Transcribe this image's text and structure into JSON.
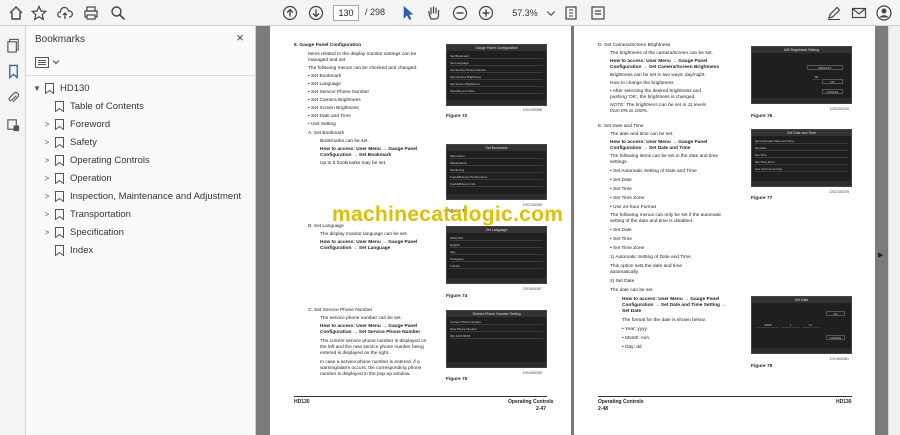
{
  "toolbar": {
    "page_current": "130",
    "page_total": "/ 298",
    "zoom": "57.3%"
  },
  "bookmarks": {
    "title": "Bookmarks",
    "close": "×",
    "root": "HD130",
    "items": [
      {
        "label": "Table of Contents",
        "expandable": false
      },
      {
        "label": "Foreword",
        "expandable": true
      },
      {
        "label": "Safety",
        "expandable": true
      },
      {
        "label": "Operating Controls",
        "expandable": true
      },
      {
        "label": "Operation",
        "expandable": true
      },
      {
        "label": "Inspection, Maintenance and Adjustment",
        "expandable": true
      },
      {
        "label": "Transportation",
        "expandable": true
      },
      {
        "label": "Specification",
        "expandable": true
      },
      {
        "label": "Index",
        "expandable": false
      }
    ]
  },
  "watermark": "machinecatalogic.com",
  "left_page": {
    "lines": [
      "6.      Gauge Panel Configuration",
      "Items related to the display monitor settings can be",
      "managed and set.",
      "The following menus can be checked and changed.",
      "•    Set Bookmark",
      "•    Set Language",
      "•    Set Service Phone Number",
      "•    Set Camera Brightness",
      "•    Set Screen Brightness",
      "•    Set Date and Time",
      "•    Unit Setting",
      "A.   Set Bookmark",
      "Bookmarks can be set.",
      "How to access: User Menu → Gauge Panel",
      "Configuration → Set Bookmark",
      "Up to 5 bookmarks may be set.",
      "B.   Set Language",
      "The display monitor language can be set.",
      "How to access: User Menu → Gauge Panel",
      "Configuration → Set Language",
      "C.   Set Service Phone Number",
      "The service phone number can be set.",
      "How to access: User Menu → Gauge Panel",
      "Configuration → Set Service Phone Number",
      "The current service phone number is displayed on",
      "the left and the new service phone number being",
      "entered is displayed on the right.",
      "In case a service phone number is entered, if a",
      "warning/alarm occurs, the corresponding phone",
      "number is displayed in the pop-up window."
    ],
    "figures": [
      {
        "title": "Gauge Panel Configuration",
        "caption": "Figure 72",
        "code": "DS2100398"
      },
      {
        "title": "Set Bookmark",
        "caption": "Figure 73",
        "code": "DS2100399"
      },
      {
        "title": "Set Language",
        "caption": "Figure 74",
        "code": "DS1900397"
      },
      {
        "title": "Service Phone Number Setting",
        "caption": "Figure 75",
        "code": "DS1900399"
      }
    ],
    "fig_rows": [
      [
        "Set Bookmark",
        "Set Language",
        "Set Service Phone Number",
        "Set Camera Brightness",
        "Set Screen Brightness",
        "Set Date and Time"
      ],
      [
        "Main Menu",
        "Maintenance",
        "Monitoring",
        "Fuel Efficiency Performance",
        "Fuel Efficiency Info"
      ],
      [
        "ENGLISH",
        "English",
        "Italy",
        "Portugues",
        "Turkish"
      ],
      [
        "Current Phone Number",
        "New Phone Number",
        "031 1234 5678"
      ]
    ],
    "footer_left": "HD130",
    "footer_right": "Operating Controls",
    "page_no": "2-47"
  },
  "right_page": {
    "lines": [
      "D.   Set Camera/Screen Brightness",
      "The brightness of the camera/screen can be set.",
      "How to access: User Menu → Gauge Panel",
      "Configuration → Set Camera/Screen Brightness",
      "Brightness can be set in two ways: day/night.",
      "How to change the brightness",
      "•    After selecting the desired brightness and",
      "      pushing 'OK', the brightness is changed.",
      "NOTE:   The brightness can be set in 11 levels",
      "              from 0% to 100%.",
      "E.   Set Date and Time",
      "The date and time can be set.",
      "How to access: User Menu → Gauge Panel",
      "Configuration → Set Date and Time",
      "The following items can be set in the date and time",
      "settings.",
      "•    Set Automatic Setting of Date and Time",
      "•    Set Date",
      "•    Set Time",
      "•    Set Time Zone",
      "•    Use 24-hour Format",
      "The following menus can only be set if the automatic",
      "setting of the date and time is disabled.",
      "•    Set Date",
      "•    Set Time",
      "•    Set Time Zone",
      "1)    Automatic Setting of Date and Time",
      "        This option sets the date and time",
      "        automatically.",
      "2)    Set Date",
      "        The date can be set.",
      "How to access: User Menu → Gauge Panel",
      "Configuration → Set Date and Time Setting →",
      "Set Date",
      "The format for the date is shown below.",
      "•    Year: yyyy",
      "•    Month: mm",
      "•    Day: dd"
    ],
    "figures": [
      {
        "title": "A/B Brightness Setting",
        "caption": "Figure 76",
        "code": "DS2100239"
      },
      {
        "title": "Set Date and Time",
        "caption": "Figure 77",
        "code": "DS2100375"
      },
      {
        "title": "Set Date",
        "caption": "Figure 78",
        "code": "DS1900381"
      }
    ],
    "fig_rows": [
      [
        "DEFAULT",
        "80",
        "OK",
        "CANCEL"
      ],
      [
        "Set Automatic Date and Time",
        "Set Date",
        "Set Time",
        "Set Time Zone",
        "Use 24-hour Format"
      ],
      [
        "2018",
        "1",
        "17",
        "OK",
        "CANCEL"
      ]
    ],
    "footer_left": "Operating Controls",
    "footer_right": "HD130",
    "page_no": "2-48"
  }
}
